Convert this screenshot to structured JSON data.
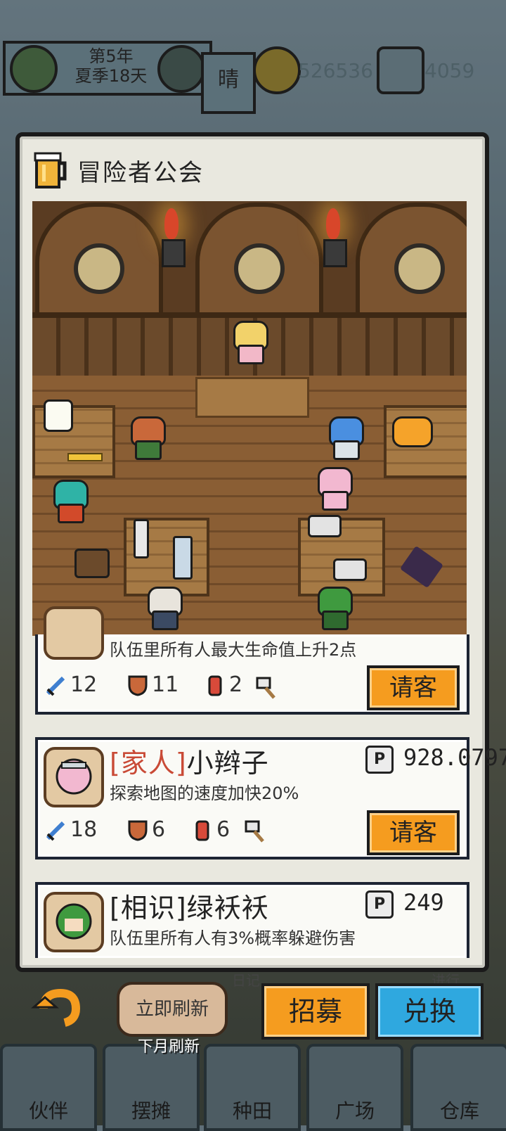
{
  "hud": {
    "year": "第5年",
    "season_day": "夏季18天",
    "weather": "晴",
    "coins": "526536",
    "gems": "4059"
  },
  "panel": {
    "title": "冒险者公会"
  },
  "cards": [
    {
      "name_rel": "",
      "name": "",
      "desc": "队伍里所有人最大生命值上升2点",
      "attack": "12",
      "defense": "11",
      "potion": "2",
      "hire_label": "请客"
    },
    {
      "name_rel": "[家人]",
      "name": "小辫子",
      "price": "928.0797",
      "desc": "探索地图的速度加快20%",
      "attack": "18",
      "defense": "6",
      "potion": "6",
      "hire_label": "请客"
    },
    {
      "name_rel": "[相识]",
      "name": "绿袄袄",
      "price": "249",
      "desc": "队伍里所有人有3%概率躲避伤害"
    }
  ],
  "price_icon_letter": "P",
  "bottom": {
    "refresh_label": "立即刷新",
    "refresh_sub": "下月刷新",
    "recruit_label": "招募",
    "exchange_label": "兑换",
    "hidden_tab_1": "日记",
    "hidden_tab_2": "进行",
    "nav": [
      "伙伴",
      "摆摊",
      "种田",
      "广场",
      "仓库"
    ]
  },
  "colors": {
    "accent_orange": "#f59c1f",
    "accent_blue": "#2fa8df",
    "relation_red": "#c94a36",
    "card_border": "#1d2433"
  }
}
